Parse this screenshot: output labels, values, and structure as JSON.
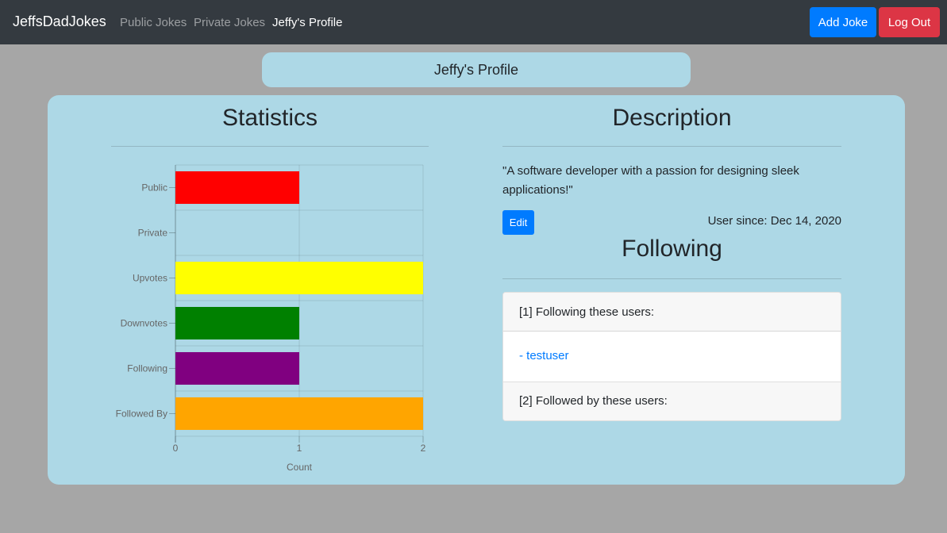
{
  "navbar": {
    "brand": "JeffsDadJokes",
    "links": [
      "Public Jokes",
      "Private Jokes",
      "Jeffy's Profile"
    ],
    "add_joke": "Add Joke",
    "log_out": "Log Out"
  },
  "profile": {
    "banner": "Jeffy's Profile",
    "statistics_title": "Statistics",
    "description_title": "Description",
    "description": "\"A software developer with a passion for designing sleek applications!\"",
    "edit_label": "Edit",
    "user_since": "User since: Dec 14, 2020",
    "following_title": "Following",
    "following_header": "[1] Following these users:",
    "following_users": [
      "- testuser"
    ],
    "followers_header": "[2] Followed by these users:"
  },
  "chart_data": {
    "type": "bar",
    "orientation": "horizontal",
    "categories": [
      "Public",
      "Private",
      "Upvotes",
      "Downvotes",
      "Following",
      "Followed By"
    ],
    "values": [
      1,
      0,
      2,
      1,
      1,
      2
    ],
    "colors": [
      "#ff0000",
      "#ff0000",
      "#ffff00",
      "#008000",
      "#800080",
      "#ffa500"
    ],
    "xlabel": "Count",
    "xticks": [
      "0",
      "1",
      "2"
    ],
    "xlim": [
      0,
      2
    ],
    "grid": true
  }
}
